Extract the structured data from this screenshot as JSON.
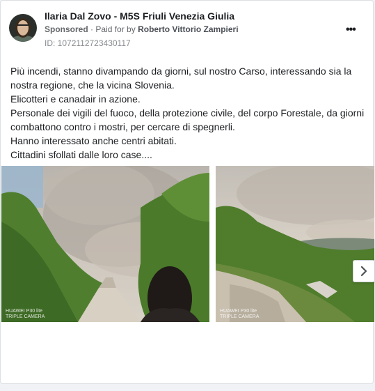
{
  "post": {
    "page_name": "Ilaria Dal Zovo - M5S Friuli Venezia Giulia",
    "sponsored_label": "Sponsored",
    "paid_for_label": "Paid for by",
    "payer": "Roberto Vittorio Zampieri",
    "ad_id": "ID: 1072112723430117",
    "more_icon": "•••",
    "text_lines": [
      "Più incendi, stanno divampando da giorni, sul nostro Carso, interessando sia la",
      "nostra regione, che la vicina Slovenia.",
      "Elicotteri e canadair in azione.",
      "Personale dei vigili del fuoco, della protezione civile, del corpo Forestale, da giorni",
      "combattono contro i mostri, per cercare di spegnerli.",
      "Hanno interessato anche centri abitati.",
      "Cittadini sfollati dalle loro case...."
    ]
  },
  "carousel": {
    "watermark_brand": "HUAWEI P30 lite",
    "watermark_camera": "TRIPLE CAMERA",
    "next_icon": "chevron-right-icon"
  }
}
